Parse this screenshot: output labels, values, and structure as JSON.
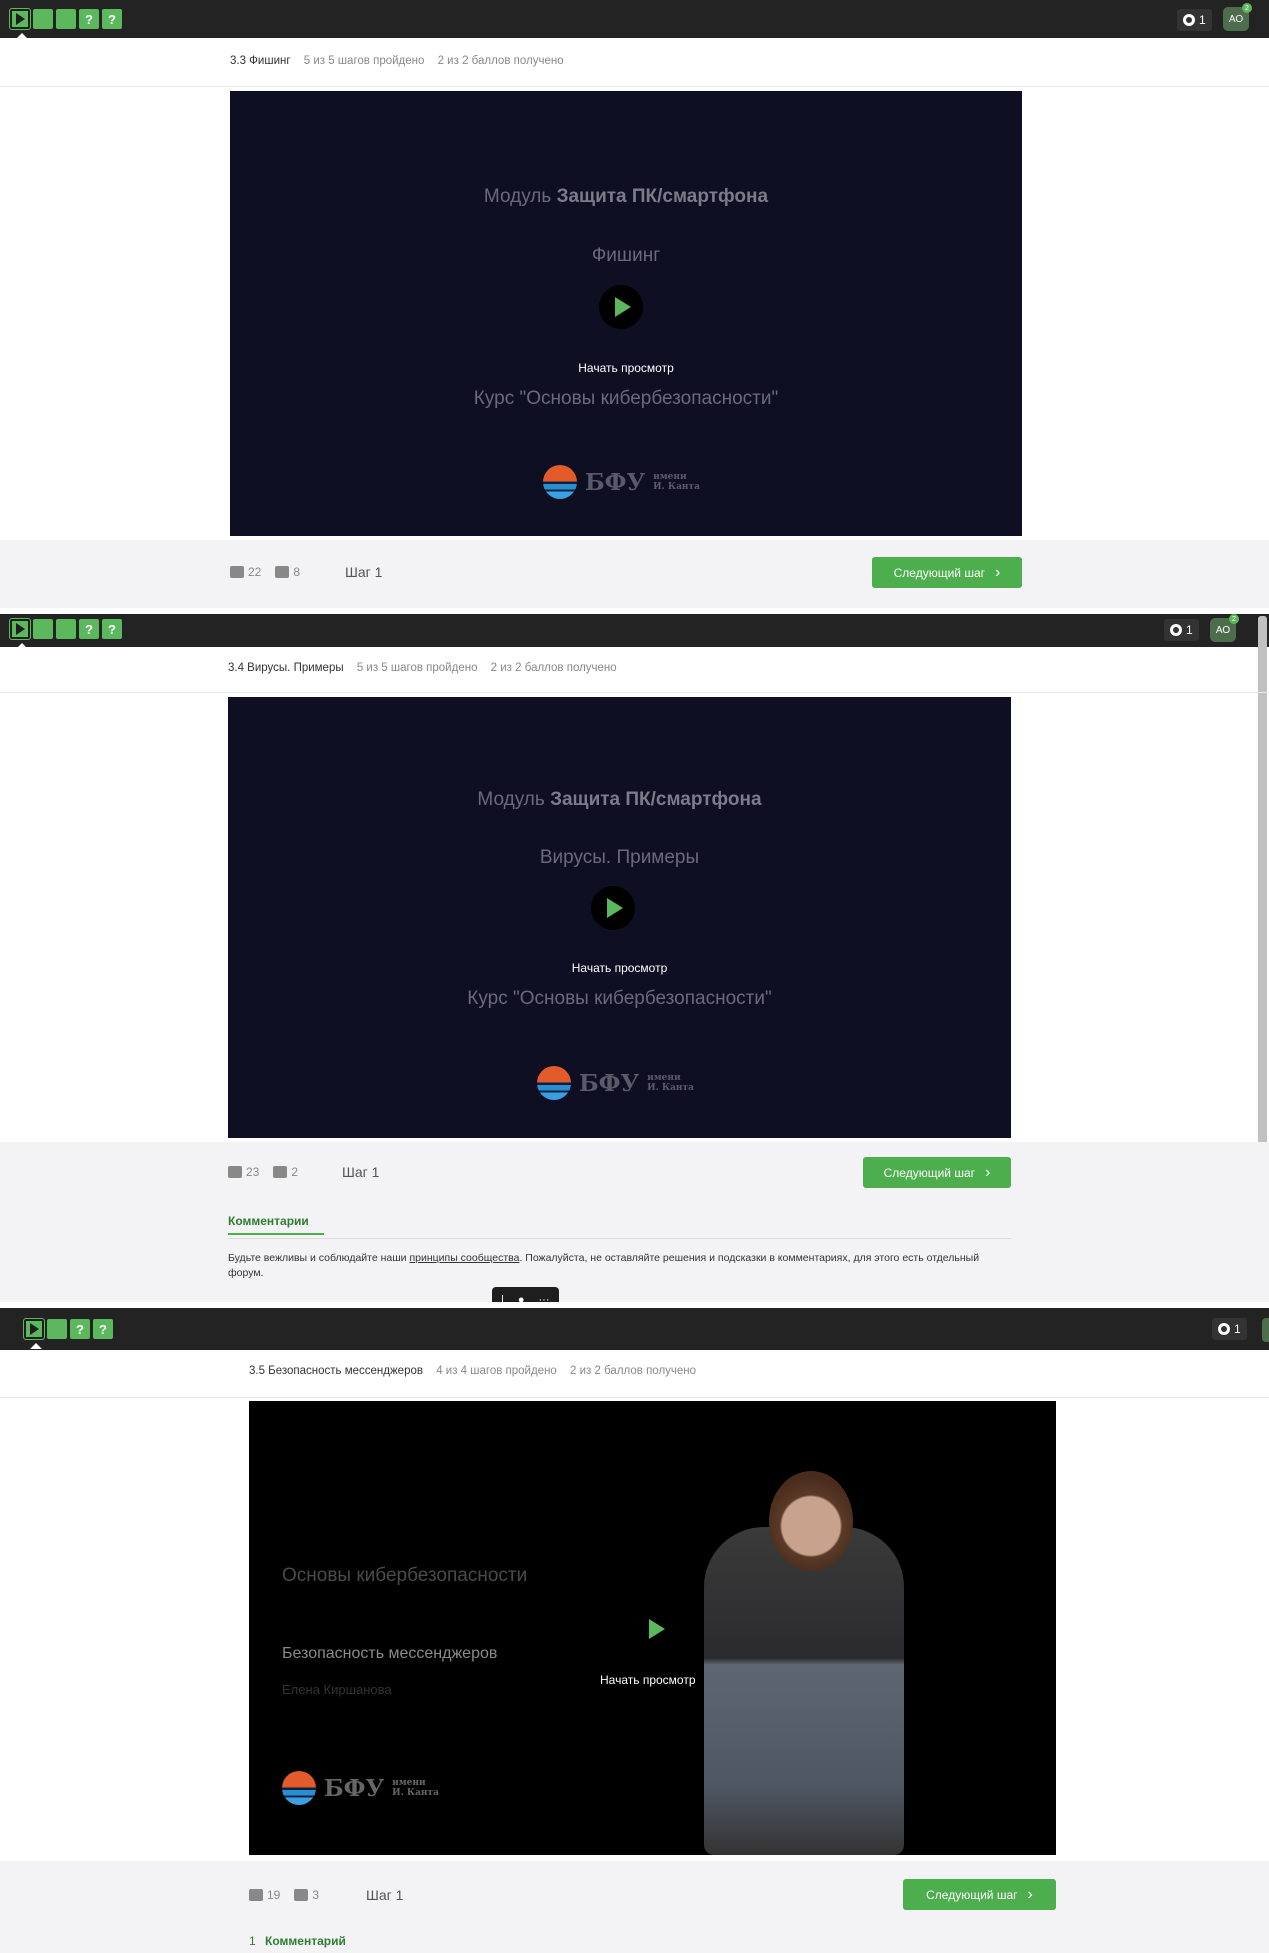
{
  "icons": [
    "play-icon",
    "question-icon",
    "hint-icon",
    "thumb-up-icon",
    "thumb-down-icon",
    "chevron-right-icon",
    "cursor-icon",
    "microphone-icon",
    "more-icon"
  ],
  "panels": [
    {
      "topbar": {
        "hint_count": "1",
        "avatar": "АО",
        "avatar_badge": "2"
      },
      "crumb": {
        "title": "3.3 Фишинг",
        "progress": "5 из 5 шагов пройдено",
        "score": "2 из 2 баллов  получено"
      },
      "video": {
        "module_prefix": "Модуль",
        "module_name": "Защита ПК/смартфона",
        "lesson": "Фишинг",
        "start": "Начать просмотр",
        "course": "Курс \"Основы кибербезопасности\"",
        "logo_name": "БФУ",
        "logo_sub1": "имени",
        "logo_sub2": "И. Канта"
      },
      "footer": {
        "likes": "22",
        "dislikes": "8",
        "step": "Шаг 1",
        "next": "Следующий шаг"
      }
    },
    {
      "topbar": {
        "hint_count": "1",
        "avatar": "АО",
        "avatar_badge": "2"
      },
      "crumb": {
        "title": "3.4 Вирусы. Примеры",
        "progress": "5 из 5 шагов пройдено",
        "score": "2 из 2 баллов  получено"
      },
      "video": {
        "module_prefix": "Модуль",
        "module_name": "Защита ПК/смартфона",
        "lesson": "Вирусы. Примеры",
        "start": "Начать просмотр",
        "course": "Курс \"Основы кибербезопасности\"",
        "logo_name": "БФУ",
        "logo_sub1": "имени",
        "logo_sub2": "И. Канта"
      },
      "footer": {
        "likes": "23",
        "dislikes": "2",
        "step": "Шаг 1",
        "next": "Следующий шаг",
        "comments_tab": "Комментарии",
        "note_before": "Будьте вежливы и соблюдайте наши ",
        "note_link": "принципы сообщества",
        "note_after": ". Пожалуйста, не оставляйте решения и подсказки в комментариях, для этого есть отдельный форум."
      }
    },
    {
      "topbar": {
        "hint_count": "1"
      },
      "crumb": {
        "title": "3.5 Безопасность мессенджеров",
        "progress": "4 из 4 шагов пройдено",
        "score": "2 из 2 баллов  получено"
      },
      "video": {
        "course": "Основы кибербезопасности",
        "lesson": "Безопасность мессенджеров",
        "author": "Елена Киршанова",
        "start": "Начать просмотр",
        "logo_name": "БФУ",
        "logo_sub1": "имени",
        "logo_sub2": "И. Канта"
      },
      "footer": {
        "likes": "19",
        "dislikes": "3",
        "step": "Шаг 1",
        "next": "Следующий шаг",
        "comments_count": "1",
        "comments_label": "Комментарий"
      }
    }
  ],
  "colors": {
    "accent": "#5cb85c",
    "topbar": "#232323",
    "video_bg": "#0f0f24",
    "footer_bg": "#f3f3f5"
  }
}
